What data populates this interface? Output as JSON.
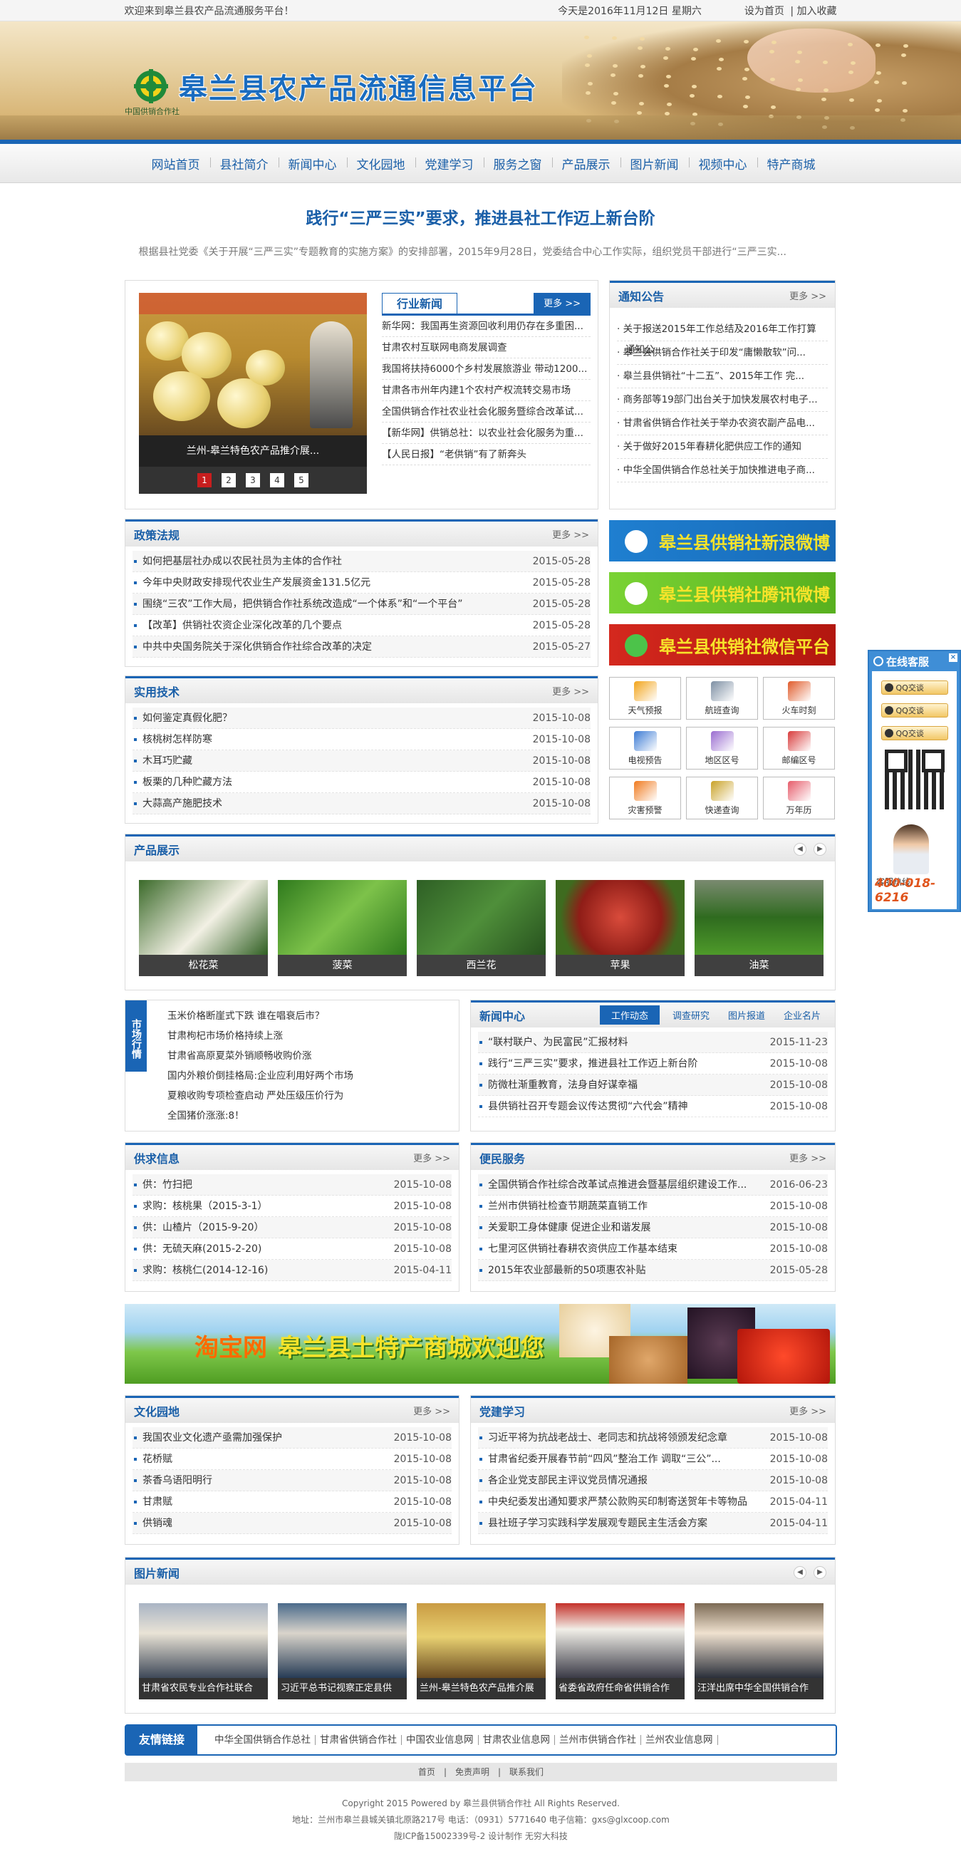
{
  "topbar": {
    "welcome": "欢迎来到皋兰县农产品流通服务平台！",
    "date": "今天是2016年11月12日 星期六",
    "set_home": "设为首页",
    "sep": "|",
    "favorite": "加入收藏"
  },
  "banner": {
    "title": "皋兰县农产品流通信息平台",
    "logo_sub": "中国供销合作社"
  },
  "nav": [
    "网站首页",
    "县社简介",
    "新闻中心",
    "文化园地",
    "党建学习",
    "服务之窗",
    "产品展示",
    "图片新闻",
    "视频中心",
    "特产商城"
  ],
  "headline": {
    "title": "践行“三严三实”要求，推进县社工作迈上新台阶",
    "summary": "根据县社党委《关于开展“三严三实”专题教育的实施方案》的安排部署，2015年9月28日，党委结合中心工作实际，组织党员干部进行“三严三实..."
  },
  "slideshow": {
    "caption": "兰州-皋兰特色农产品推介展...",
    "pages": [
      "1",
      "2",
      "3",
      "4",
      "5"
    ]
  },
  "industry_news": {
    "title": "行业新闻",
    "more": "更多 >>",
    "items": [
      "新华网：我国再生资源回收利用仍存在多重困...",
      "甘肃农村互联网电商发展调查",
      "我国将扶持6000个乡村发展旅游业 带动1200...",
      "甘肃各市州年内建1个农村产权流转交易市场",
      "全国供销合作社农业社会化服务暨综合改革试...",
      "【新华网】供销总社：以农业社会化服务为重...",
      "【人民日报】“老供销”有了新奔头"
    ]
  },
  "notices": {
    "title": "通知公告",
    "more": "更多 >>",
    "items": [
      "· 关于报送2015年工作总结及2016年工作打算",
      "· 皋兰县供销合作社关于印发“庸懒散软”问...",
      "· 皋兰县供销社“十二五”、2015年工作 完...",
      "· 商务部等19部门出台关于加快发展农村电子...",
      "· 甘肃省供销合作社关于举办农资农副产品电...",
      "· 关于做好2015年春耕化肥供应工作的通知",
      "· 中华全国供销合作总社关于加快推进电子商..."
    ],
    "overlap": "通知公"
  },
  "policy": {
    "title": "政策法规",
    "more": "更多 >>",
    "items": [
      {
        "t": "如何把基层社办成以农民社员为主体的合作社",
        "d": "2015-05-28"
      },
      {
        "t": "今年中央财政安排现代农业生产发展资金131.5亿元",
        "d": "2015-05-28"
      },
      {
        "t": "围绕“三农”工作大局，把供销合作社系统改造成“一个体系”和“一个平台”",
        "d": "2015-05-28"
      },
      {
        "t": "【改革】供销社农资企业深化改革的几个要点",
        "d": "2015-05-28"
      },
      {
        "t": "中共中央国务院关于深化供销合作社综合改革的决定",
        "d": "2015-05-27"
      }
    ]
  },
  "tech": {
    "title": "实用技术",
    "more": "更多 >>",
    "items": [
      {
        "t": "如何鉴定真假化肥？",
        "d": "2015-10-08"
      },
      {
        "t": "核桃树怎样防寒",
        "d": "2015-10-08"
      },
      {
        "t": "木耳巧贮藏",
        "d": "2015-10-08"
      },
      {
        "t": "板栗的几种贮藏方法",
        "d": "2015-10-08"
      },
      {
        "t": "大蒜高产施肥技术",
        "d": "2015-10-08"
      }
    ]
  },
  "weibo": {
    "sina": "皋兰县供销社新浪微博",
    "tencent": "皋兰县供销社腾讯微博",
    "wechat": "皋兰县供销社微信平台",
    "colors": {
      "sina": "#1e79c8",
      "tencent": "#6ac22a",
      "wechat": "#c8221e"
    }
  },
  "tools": [
    "天气预报",
    "航班查询",
    "火车时刻",
    "电视预告",
    "地区区号",
    "邮编区号",
    "灾害预警",
    "快递查询",
    "万年历"
  ],
  "products": {
    "title": "产品展示",
    "items": [
      "松花菜",
      "菠菜",
      "西兰花",
      "苹果",
      "油菜"
    ]
  },
  "market": {
    "side": "市场行情",
    "items": [
      "玉米价格断崖式下跌 谁在唱衰后市？",
      "甘肃枸杞市场价格持续上涨",
      "甘肃省高原夏菜外销顺畅收购价涨",
      "国内外粮价倒挂格局:企业应利用好两个市场",
      "夏粮收购专项检查启动 严处压级压价行为",
      "全国猪价涨涨:8！"
    ]
  },
  "news_center": {
    "title": "新闻中心",
    "tabs": [
      "工作动态",
      "调查研究",
      "图片报道",
      "企业名片"
    ],
    "items": [
      {
        "t": "“联村联户、为民富民”汇报材料",
        "d": "2015-11-23"
      },
      {
        "t": "践行“三严三实”要求，推进县社工作迈上新台阶",
        "d": "2015-10-08"
      },
      {
        "t": "防微杜渐重教育，法身自好谋幸福",
        "d": "2015-10-08"
      },
      {
        "t": "县供销社召开专题会议传达贯彻“六代会”精神",
        "d": "2015-10-08"
      }
    ]
  },
  "supply": {
    "title": "供求信息",
    "more": "更多 >>",
    "items": [
      {
        "t": "供：竹扫把",
        "d": "2015-10-08"
      },
      {
        "t": "求购：核桃果（2015-3-1）",
        "d": "2015-10-08"
      },
      {
        "t": "供：山楂片（2015-9-20）",
        "d": "2015-10-08"
      },
      {
        "t": "供：无硫天麻(2015-2-20)",
        "d": "2015-10-08"
      },
      {
        "t": "求购：核桃仁(2014-12-16)",
        "d": "2015-04-11"
      }
    ]
  },
  "service": {
    "title": "便民服务",
    "more": "更多 >>",
    "items": [
      {
        "t": "全国供销合作社综合改革试点推进会暨基层组织建设工作...",
        "d": "2016-06-23"
      },
      {
        "t": "兰州市供销社检查节期蔬菜直销工作",
        "d": "2015-10-08"
      },
      {
        "t": "关爱职工身体健康 促进企业和谐发展",
        "d": "2015-10-08"
      },
      {
        "t": "七里河区供销社春耕农资供应工作基本结束",
        "d": "2015-10-08"
      },
      {
        "t": "2015年农业部最新的50项惠农补贴",
        "d": "2015-05-28"
      }
    ]
  },
  "mall_banner": {
    "brand": "淘宝网",
    "text": "皋兰县土特产商城欢迎您"
  },
  "culture": {
    "title": "文化园地",
    "more": "更多 >>",
    "items": [
      {
        "t": "我国农业文化遗产亟需加强保护",
        "d": "2015-10-08"
      },
      {
        "t": "花桥赋",
        "d": "2015-10-08"
      },
      {
        "t": "茶香乌语阳明行",
        "d": "2015-10-08"
      },
      {
        "t": "甘肃赋",
        "d": "2015-10-08"
      },
      {
        "t": "供销魂",
        "d": "2015-10-08"
      }
    ]
  },
  "party": {
    "title": "党建学习",
    "more": "更多 >>",
    "items": [
      {
        "t": "习近平将为抗战老战士、老同志和抗战将领颁发纪念章",
        "d": "2015-10-08"
      },
      {
        "t": "甘肃省纪委开展春节前“四风”整治工作 调取“三公”...",
        "d": "2015-10-08"
      },
      {
        "t": "各企业党支部民主评议党员情况通报",
        "d": "2015-10-08"
      },
      {
        "t": "中央纪委发出通知要求严禁公款购买印制寄送贺年卡等物品",
        "d": "2015-04-11"
      },
      {
        "t": "县社班子学习实践科学发展观专题民主生活会方案",
        "d": "2015-04-11"
      }
    ]
  },
  "photo_news": {
    "title": "图片新闻",
    "items": [
      "甘肃省农民专业合作社联合",
      "习近平总书记视察正定县供",
      "兰州-皋兰特色农产品推介展",
      "省委省政府任命省供销合作",
      "汪洋出席中华全国供销合作"
    ]
  },
  "friend_links": {
    "title": "友情链接",
    "items": [
      "中华全国供销合作总社",
      "甘肃省供销合作社",
      "中国农业信息网",
      "甘肃农业信息网",
      "兰州市供销合作社",
      "兰州农业信息网"
    ]
  },
  "footer": {
    "nav": [
      "首页",
      "免责声明",
      "联系我们"
    ],
    "sep": "|",
    "copyright": "Copyright 2015 Powered by 皋兰县供销合作社 All Rights Reserved.",
    "address": "地址：兰州市皋兰县城关镇北原路217号 电话：（0931）5771640 电子信箱：gxs@glxcoop.com",
    "icp": "陇ICP备15002339号-2 设计制作 无穷大科技"
  },
  "kefu": {
    "title": "在线客服",
    "close": "×",
    "qq": [
      "QQ交谈",
      "QQ交谈",
      "QQ交谈"
    ],
    "hotline_label": "客服热线",
    "hotline": "400-018-6216"
  },
  "more_arrow": "更多 >>"
}
